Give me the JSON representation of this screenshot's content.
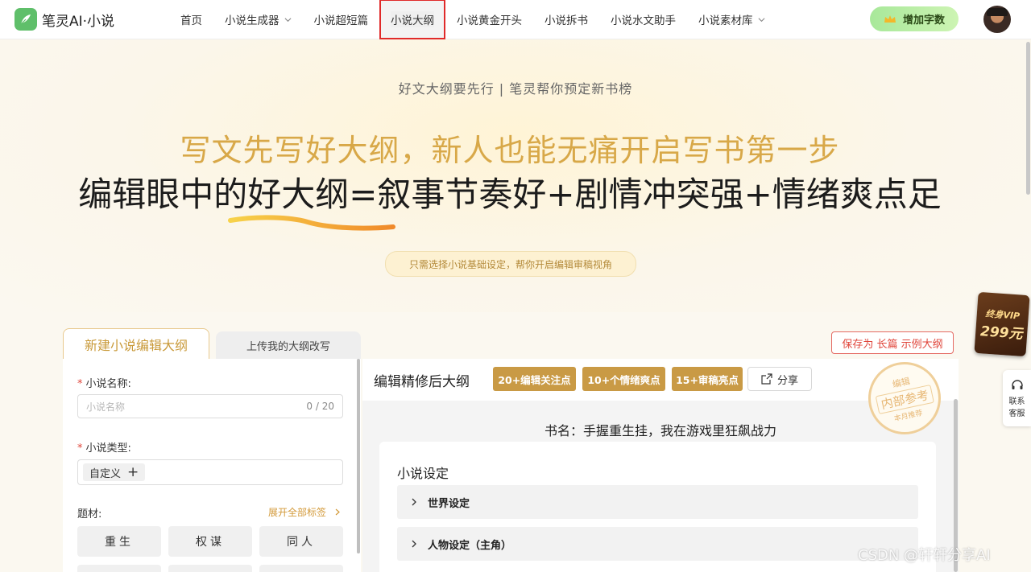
{
  "header": {
    "logo_text": "笔灵AI·小说",
    "nav": [
      {
        "label": "首页",
        "dropdown": false,
        "active": false
      },
      {
        "label": "小说生成器",
        "dropdown": true,
        "active": false
      },
      {
        "label": "小说超短篇",
        "dropdown": false,
        "active": false
      },
      {
        "label": "小说大纲",
        "dropdown": false,
        "active": true
      },
      {
        "label": "小说黄金开头",
        "dropdown": false,
        "active": false
      },
      {
        "label": "小说拆书",
        "dropdown": false,
        "active": false
      },
      {
        "label": "小说水文助手",
        "dropdown": false,
        "active": false
      },
      {
        "label": "小说素材库",
        "dropdown": true,
        "active": false
      }
    ],
    "add_words_label": "增加字数"
  },
  "hero": {
    "sub_slogan": "好文大纲要先行 | 笔灵帮你预定新书榜",
    "title_gold": "写文先写好大纲，新人也能无痛开启写书第一步",
    "title_dark": "编辑眼中的好大纲=叙事节奏好+剧情冲突强+情绪爽点足",
    "hint": "只需选择小说基础设定，帮你开启编辑审稿视角"
  },
  "form": {
    "tab_new": "新建小说编辑大纲",
    "tab_upload": "上传我的大纲改写",
    "name_label": "小说名称:",
    "name_placeholder": "小说名称",
    "name_counter": "0 / 20",
    "type_label": "小说类型:",
    "type_tag": "自定义",
    "genre_label": "题材:",
    "expand_label": "展开全部标签",
    "genres": [
      "重生",
      "权谋",
      "同人"
    ]
  },
  "result": {
    "save_label": "保存为 长篇 示例大纲",
    "title": "编辑精修后大纲",
    "badges": [
      "20+编辑关注点",
      "10+个情绪爽点",
      "15+审稿亮点"
    ],
    "share_label": "分享",
    "stamp": {
      "top": "编辑",
      "middle": "内部参考",
      "bottom": "本月推荐"
    },
    "book_name": "书名：手握重生挂，我在游戏里狂飙战力",
    "section_title": "小说设定",
    "sections": [
      "世界设定",
      "人物设定（主角）"
    ]
  },
  "side": {
    "vip_line1": "终身VIP",
    "vip_line2": "299元",
    "support_line1": "联系",
    "support_line2": "客服"
  },
  "watermark": "CSDN @轩轩分享AI",
  "colors": {
    "accent_gold": "#d8a848",
    "badge_gold": "#c99a45",
    "active_outline": "#e02a2a",
    "add_button": "#a8e89a"
  }
}
